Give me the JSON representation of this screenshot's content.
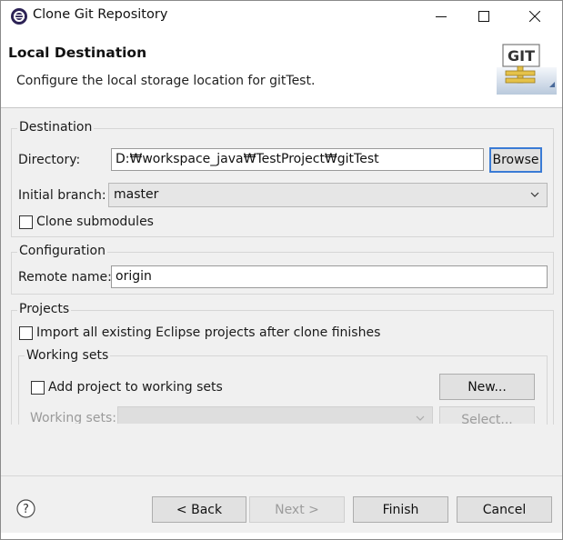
{
  "window": {
    "title": "Clone Git Repository",
    "icon": "eclipse-icon"
  },
  "banner": {
    "title": "Local Destination",
    "description": "Configure the local storage location for gitTest.",
    "logo_text": "GIT"
  },
  "destination": {
    "group_title": "Destination",
    "directory_label": "Directory:",
    "directory_value": "D:₩workspace_java₩TestProject₩gitTest",
    "browse_label": "Browse",
    "branch_label": "Initial branch:",
    "branch_value": "master",
    "clone_submodules_label": "Clone submodules",
    "clone_submodules_checked": false
  },
  "configuration": {
    "group_title": "Configuration",
    "remote_name_label": "Remote name:",
    "remote_name_value": "origin"
  },
  "projects": {
    "group_title": "Projects",
    "import_label": "Import all existing Eclipse projects after clone finishes",
    "import_checked": false,
    "working_sets": {
      "group_title": "Working sets",
      "add_label": "Add project to working sets",
      "add_checked": false,
      "new_label": "New...",
      "working_sets_label": "Working sets:",
      "select_label": "Select..."
    }
  },
  "footer": {
    "help_icon": "help-icon",
    "back_label": "< Back",
    "next_label": "Next >",
    "finish_label": "Finish",
    "cancel_label": "Cancel"
  },
  "colors": {
    "window_bg": "#f0f0f0",
    "default_button_border": "#3a7bd5"
  }
}
